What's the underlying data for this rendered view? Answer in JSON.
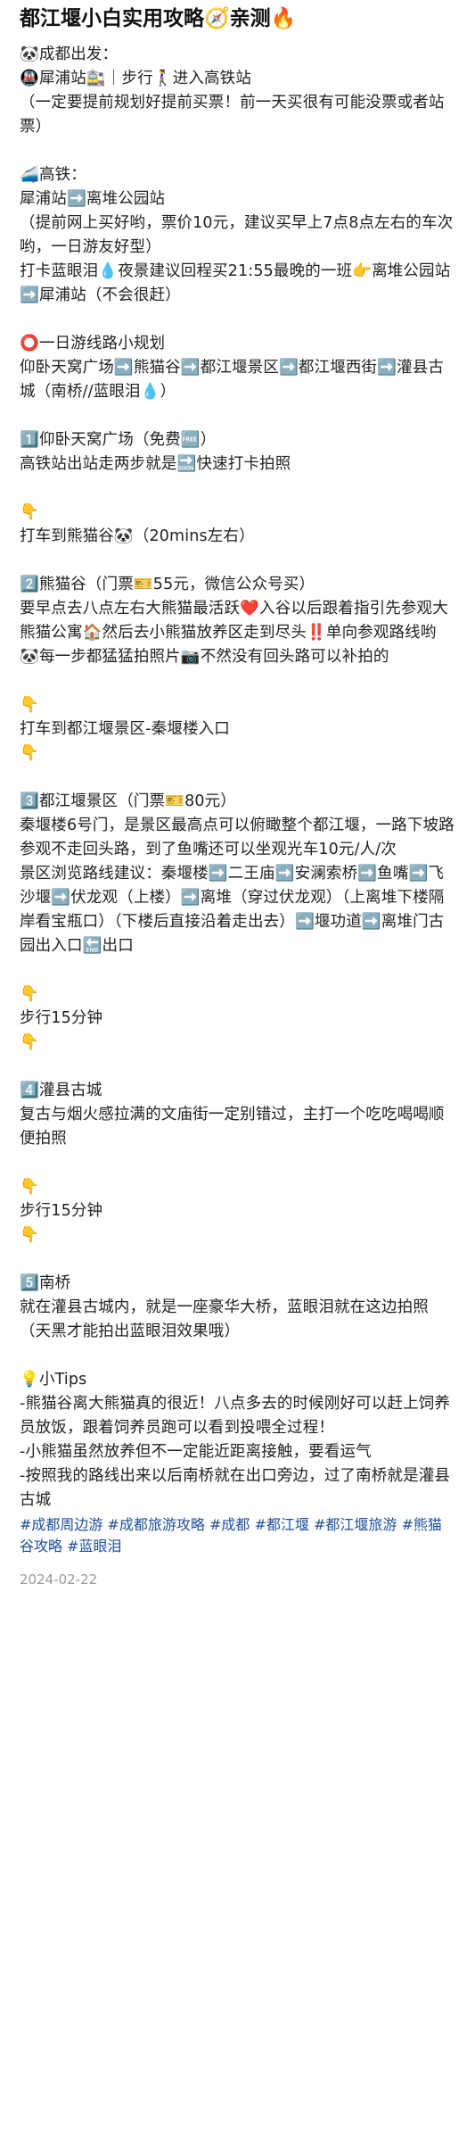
{
  "title": "都江堰小白实用攻略🧭亲测🔥",
  "lines": [
    "🐼成都出发：",
    "🚇犀浦站🚉｜步行🚶‍♀️进入高铁站",
    "（一定要提前规划好提前买票！前一天买很有可能没票或者站票）",
    "",
    "🚄高铁：",
    "犀浦站➡️离堆公园站",
    "（提前网上买好哟，票价10元，建议买早上7点8点左右的车次哟，一日游友好型）",
    "打卡蓝眼泪💧夜景建议回程买21:55最晚的一班👉离堆公园站➡️犀浦站（不会很赶）",
    "",
    "⭕一日游线路小规划",
    "仰卧天窝广场➡️熊猫谷➡️都江堰景区➡️都江堰西街➡️灌县古城（南桥//蓝眼泪💧）",
    "",
    "1️⃣仰卧天窝广场（免费🆓）",
    "高铁站出站走两步就是🔜快速打卡拍照",
    "",
    "👇",
    "打车到熊猫谷🐼（20mins左右）",
    "",
    "2️⃣熊猫谷（门票🎫55元，微信公众号买）",
    "要早点去八点左右大熊猫最活跃❤️入谷以后跟着指引先参观大熊猫公寓🏠然后去小熊猫放养区走到尽头‼️单向参观路线哟🐼每一步都猛猛拍照片📷不然没有回头路可以补拍的",
    "",
    "👇",
    "打车到都江堰景区-秦堰楼入口",
    "👇",
    "",
    "3️⃣都江堰景区（门票🎫80元）",
    "秦堰楼6号门，是景区最高点可以俯瞰整个都江堰，一路下坡路参观不走回头路，到了鱼嘴还可以坐观光车10元/人/次",
    "景区浏览路线建议：秦堰楼➡️二王庙➡️安澜索桥➡️鱼嘴➡️飞沙堰➡️伏龙观（上楼）➡️离堆（穿过伏龙观）（上离堆下楼隔岸看宝瓶口）（下楼后直接沿着走出去）➡️堰功道➡️离堆门古园出入口🔚出口",
    "",
    "👇",
    "步行15分钟",
    "👇",
    "",
    "4️⃣灌县古城",
    "复古与烟火感拉满的文庙街一定别错过，主打一个吃吃喝喝顺便拍照",
    "",
    "👇",
    "步行15分钟",
    "👇",
    "",
    "5️⃣南桥",
    "就在灌县古城内，就是一座豪华大桥，蓝眼泪就在这边拍照（天黑才能拍出蓝眼泪效果哦）",
    "",
    "💡小Tips",
    "-熊猫谷离大熊猫真的很近！八点多去的时候刚好可以赶上饲养员放饭，跟着饲养员跑可以看到投喂全过程！",
    "-小熊猫虽然放养但不一定能近距离接触，要看运气",
    "-按照我的路线出来以后南桥就在出口旁边，过了南桥就是灌县古城"
  ],
  "tags": "#成都周边游 #成都旅游攻略 #成都 #都江堰 #都江堰旅游 #熊猫谷攻略 #蓝眼泪",
  "date": "2024-02-22"
}
